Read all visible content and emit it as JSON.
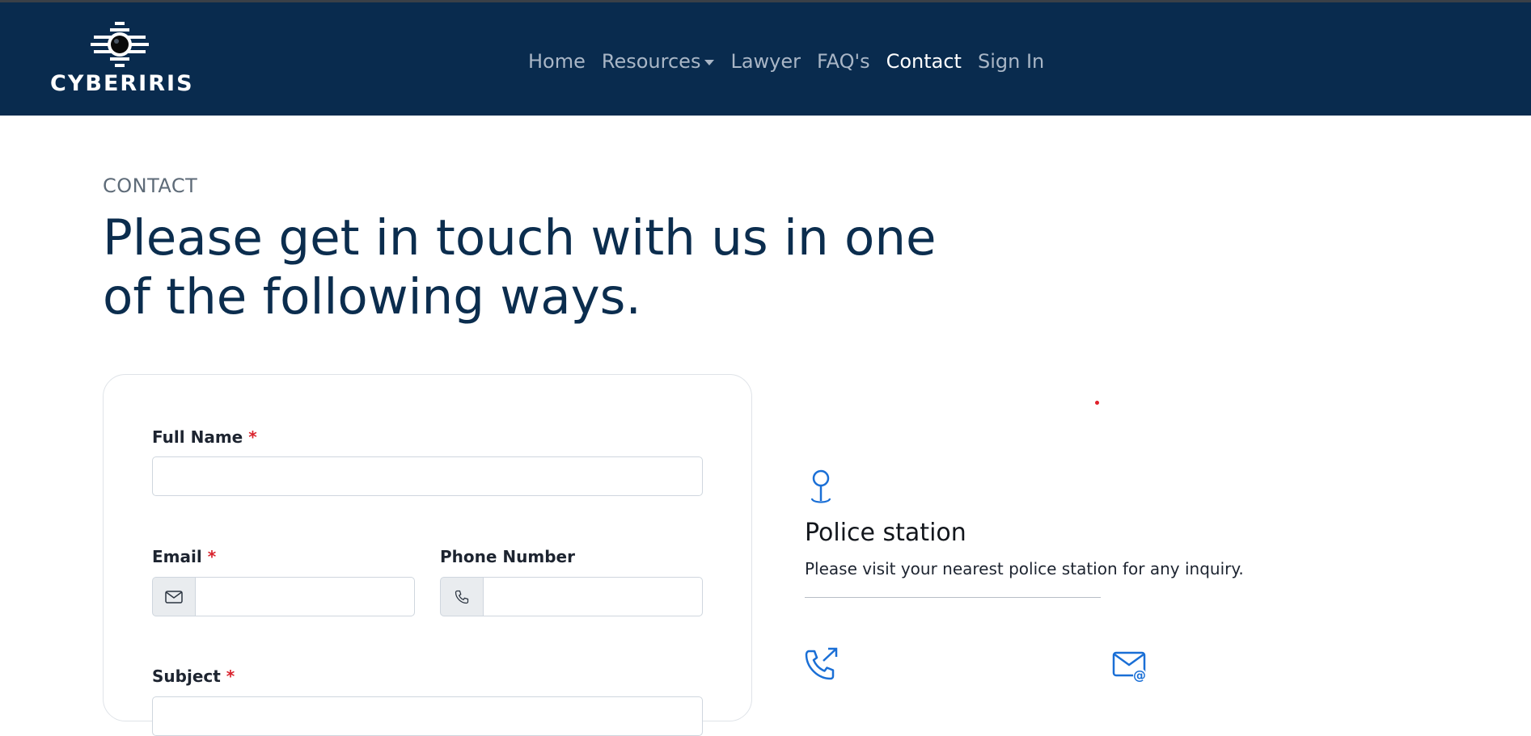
{
  "brand": {
    "name": "CYBERIRIS"
  },
  "nav": {
    "items": [
      {
        "label": "Home"
      },
      {
        "label": "Resources"
      },
      {
        "label": "Lawyer"
      },
      {
        "label": "FAQ's"
      },
      {
        "label": "Contact"
      },
      {
        "label": "Sign In"
      }
    ],
    "active": "Contact"
  },
  "hero": {
    "eyebrow": "CONTACT",
    "title": "Please get in touch with us in one of the following ways."
  },
  "form": {
    "full_name": {
      "label": "Full Name",
      "required_mark": "*",
      "value": ""
    },
    "email": {
      "label": "Email",
      "required_mark": "*",
      "value": "",
      "icon": "envelope-icon"
    },
    "phone": {
      "label": "Phone Number",
      "value": "",
      "icon": "phone-icon"
    },
    "subject": {
      "label": "Subject",
      "required_mark": "*",
      "value": ""
    }
  },
  "info": {
    "police": {
      "icon": "map-pin-icon",
      "title": "Police station",
      "text": "Please visit your nearest police station for any inquiry."
    },
    "call": {
      "icon": "phone-outgoing-icon",
      "title": ""
    },
    "email": {
      "icon": "email-at-icon",
      "title": ""
    }
  },
  "colors": {
    "navbar": "#092b4e",
    "heading": "#0b2d4e",
    "accent": "#1a6fd6",
    "required": "#d9232d"
  }
}
